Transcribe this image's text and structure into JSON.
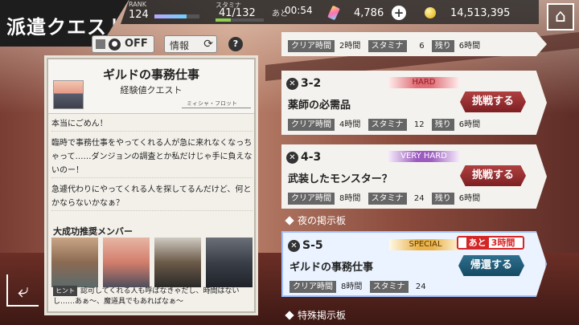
{
  "header": {
    "title": "派遣クエスト",
    "rank_label": "RANK",
    "rank_value": "124",
    "rank_progress": 0.72,
    "stamina_label": "スタミナ",
    "stamina_value": "41/132",
    "stamina_progress": 0.31,
    "recover_label": "あと",
    "recover_time": "00:54",
    "gems": "4,786",
    "plus_label": "+",
    "gold": "14,513,395",
    "home_label": "⌂"
  },
  "controls": {
    "notice_state": "OFF",
    "info_label": "情報",
    "help_label": "?"
  },
  "quest_detail": {
    "title": "ギルドの事務仕事",
    "subtitle": "経験値クエスト",
    "npc_name": "ミィシャ・フロット",
    "dialogue": [
      "本当にごめん！",
      "臨時で事務仕事をやってくれる人が急に来れなくなっちゃって……ダンジョンの調査とか私だけじゃ手に負えないのー！",
      "急遽代わりにやってくれる人を探してるんだけど、何とかならないかなぁ？"
    ],
    "recommended_title": "大成功推奨メンバー",
    "hint_label": "ヒント",
    "hint_text": "認可してくれる人も呼ばなきゃだし、時間はないし……あぁ～、魔道具でもあればなぁ～"
  },
  "labels": {
    "clear_time": "クリア時間",
    "stamina": "スタミナ",
    "remaining": "残り"
  },
  "quests": [
    {
      "id": "",
      "difficulty": "",
      "name": "",
      "clear_time": "2時間",
      "stamina": "6",
      "remaining": "6時間",
      "button": ""
    },
    {
      "id": "3-2",
      "difficulty": "HARD",
      "name": "薬師の必需品",
      "clear_time": "4時間",
      "stamina": "12",
      "remaining": "6時間",
      "button": "挑戦する"
    },
    {
      "id": "4-3",
      "difficulty": "VERY HARD",
      "name": "武装したモンスター？",
      "clear_time": "8時間",
      "stamina": "24",
      "remaining": "6時間",
      "button": "挑戦する"
    },
    {
      "id": "S-5",
      "difficulty": "SPECIAL",
      "name": "ギルドの事務仕事",
      "clear_time": "8時間",
      "stamina": "24",
      "remaining": "",
      "button": "帰還する",
      "time_left_label": "あと",
      "time_left": "3時間"
    }
  ],
  "sections": {
    "night_board": "夜の掲示板",
    "special_board": "特殊掲示板"
  },
  "colors": {
    "accent_red": "#7d1f23",
    "accent_blue": "#144a63"
  }
}
